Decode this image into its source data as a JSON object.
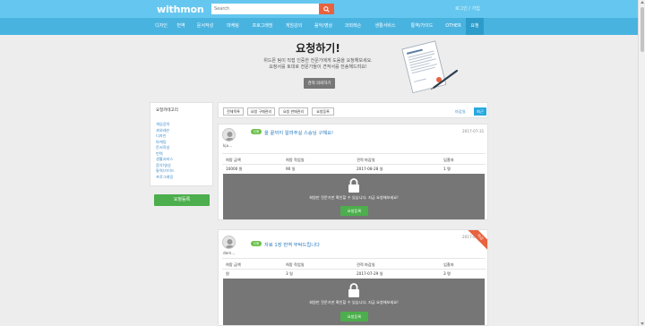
{
  "header": {
    "logo": "withmon",
    "search_placeholder": "Search",
    "auth_links": "로그인 / 가입"
  },
  "nav": {
    "items": [
      {
        "label": "디자인"
      },
      {
        "label": "번역"
      },
      {
        "label": "문서작성"
      },
      {
        "label": "마케팅"
      },
      {
        "label": "프로그래밍"
      },
      {
        "label": "게임강의"
      },
      {
        "label": "음악/영상"
      },
      {
        "label": "과외레슨"
      },
      {
        "label": "생활서비스"
      },
      {
        "label": "통역/가이드"
      },
      {
        "label": "OTHER"
      },
      {
        "label": "요청"
      }
    ],
    "active_index": 11
  },
  "hero": {
    "title": "요청하기!",
    "line1": "위드몬 팀이 직접 인증한 전문가에게 도움을 요청해보세요.",
    "line2": "요청서를 토대로 전문가들이 견적서를 전송해드려요!",
    "button": "견적 의뢰하기"
  },
  "sidebar": {
    "title": "요청카테고리",
    "categories": [
      "게임강의",
      "과외레슨",
      "디자인",
      "마케팅",
      "문서작성",
      "번역",
      "생활서비스",
      "음악/영상",
      "통역/가이드",
      "프로그래밍"
    ],
    "register_button": "요청등록"
  },
  "filters": {
    "buttons": [
      "전체목록",
      "요청 구매관리",
      "요청 판매관리",
      "요청등록"
    ],
    "sort_deadline": "마감일",
    "sort_latest": "최근"
  },
  "columns": [
    "희망 금액",
    "희망 작업일",
    "견적 마감일",
    "입찰자"
  ],
  "lock": {
    "message": "회원만 전문가만 확인할 수 있습니다. 지금 요청해보세요!",
    "button": "요청등록"
  },
  "cards": [
    {
      "user": "kju...",
      "date": "2017-07-31",
      "badge": "신청",
      "title": "을 끝까지 알려주실 스승님 구해요!",
      "price": "10000 원",
      "days": "90 일",
      "deadline": "2017-08-28 일",
      "bidders": "1 명"
    },
    {
      "user": "dem...",
      "date": "2017-0",
      "badge": "신청",
      "title": "자료 1장 번역 부탁드립니다",
      "price": "원",
      "days": "3 일",
      "deadline": "2017-07-29 일",
      "bidders": "3 명",
      "ribbon": "마감"
    }
  ]
}
